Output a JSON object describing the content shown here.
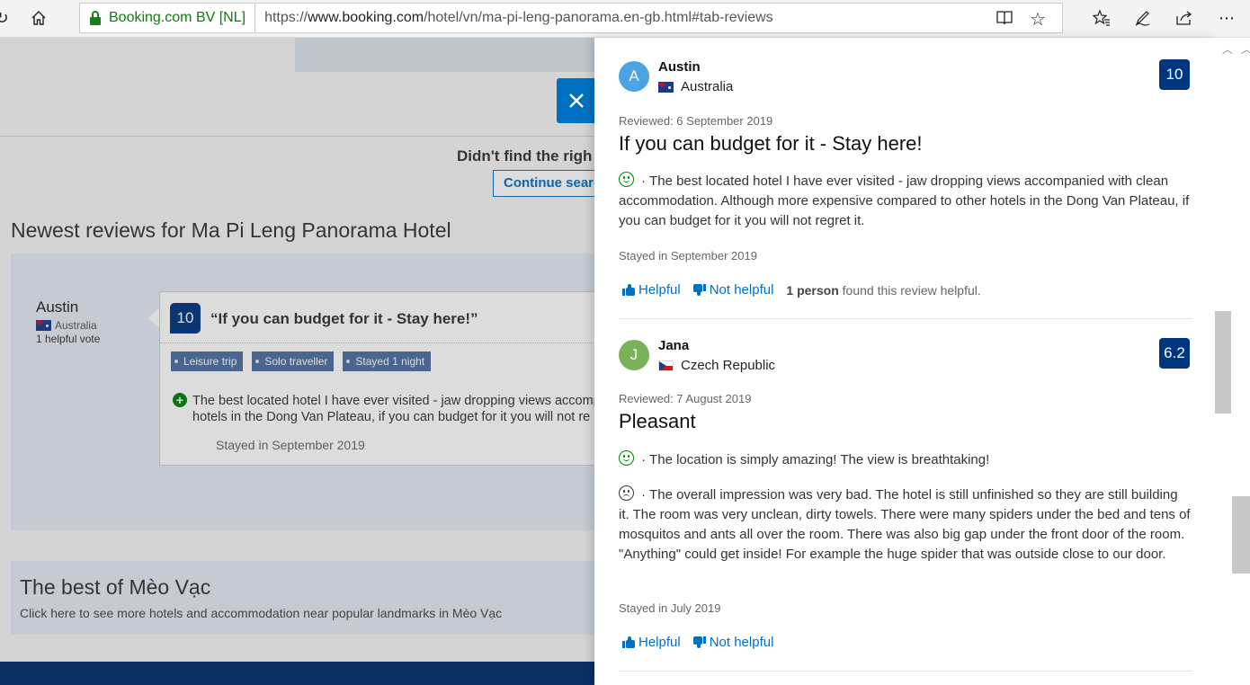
{
  "browser": {
    "company": "Booking.com BV [NL]",
    "url_prefix": "https://",
    "url_domain": "www.booking.com",
    "url_path": "/hotel/vn/ma-pi-leng-panorama.en-gb.html#tab-reviews"
  },
  "background_page": {
    "didnt_find": "Didn't find the righ",
    "continue_label": "Continue searc",
    "newest_heading": "Newest reviews for Ma Pi Leng Panorama Hotel",
    "reviewer": {
      "name": "Austin",
      "country": "Australia",
      "votes": "1 helpful vote"
    },
    "card": {
      "score": "10",
      "title": "“If you can budget for it - Stay here!”",
      "tags": [
        "Leisure trip",
        "Solo traveller",
        "Stayed 1 night"
      ],
      "positive": "The best located hotel I have ever visited - jaw dropping views accomp hotels in the Dong Van Plateau, if you can budget for it you will not re",
      "stayed": "Stayed in September 2019"
    },
    "best": {
      "heading": "The best of Mèo Vạc",
      "text": "Click here to see more hotels and accommodation near popular landmarks in Mèo Vạc"
    }
  },
  "panel": {
    "reviews": [
      {
        "initial": "A",
        "avatar_color": "#4ba3e3",
        "name": "Austin",
        "country": "Australia",
        "score": "10",
        "reviewed": "Reviewed: 6 September 2019",
        "title": "If you can budget for it - Stay here!",
        "positive": " · The best located hotel I have ever visited - jaw dropping views accompanied with clean accommodation. Although more expensive compared to other hotels in the Dong Van Plateau, if you can budget for it you will not regret it.",
        "stayed": "Stayed in September 2019",
        "helpful": "Helpful",
        "not_helpful": "Not helpful",
        "helpful_count_bold": "1 person",
        "helpful_count_rest": " found this review helpful."
      },
      {
        "initial": "J",
        "avatar_color": "#7ab259",
        "name": "Jana",
        "country": "Czech Republic",
        "score": "6.2",
        "reviewed": "Reviewed: 7 August 2019",
        "title": "Pleasant",
        "positive": " · The location is simply amazing! The view is breathtaking!",
        "negative": " · The overall impression was very bad. The hotel is still unfinished so they are still building it. The room was very unclean, dirty towels. There were many spiders under the bed and tens of mosquitos and ants all over the room. There was also big gap under the front door of the room. \"Anything\" could get inside! For example the huge spider that was outside close to our door.",
        "stayed": "Stayed in July 2019",
        "helpful": "Helpful",
        "not_helpful": "Not helpful"
      }
    ]
  },
  "colors": {
    "brand_blue": "#003580",
    "link_blue": "#0071c2",
    "positive_green": "#008009"
  }
}
